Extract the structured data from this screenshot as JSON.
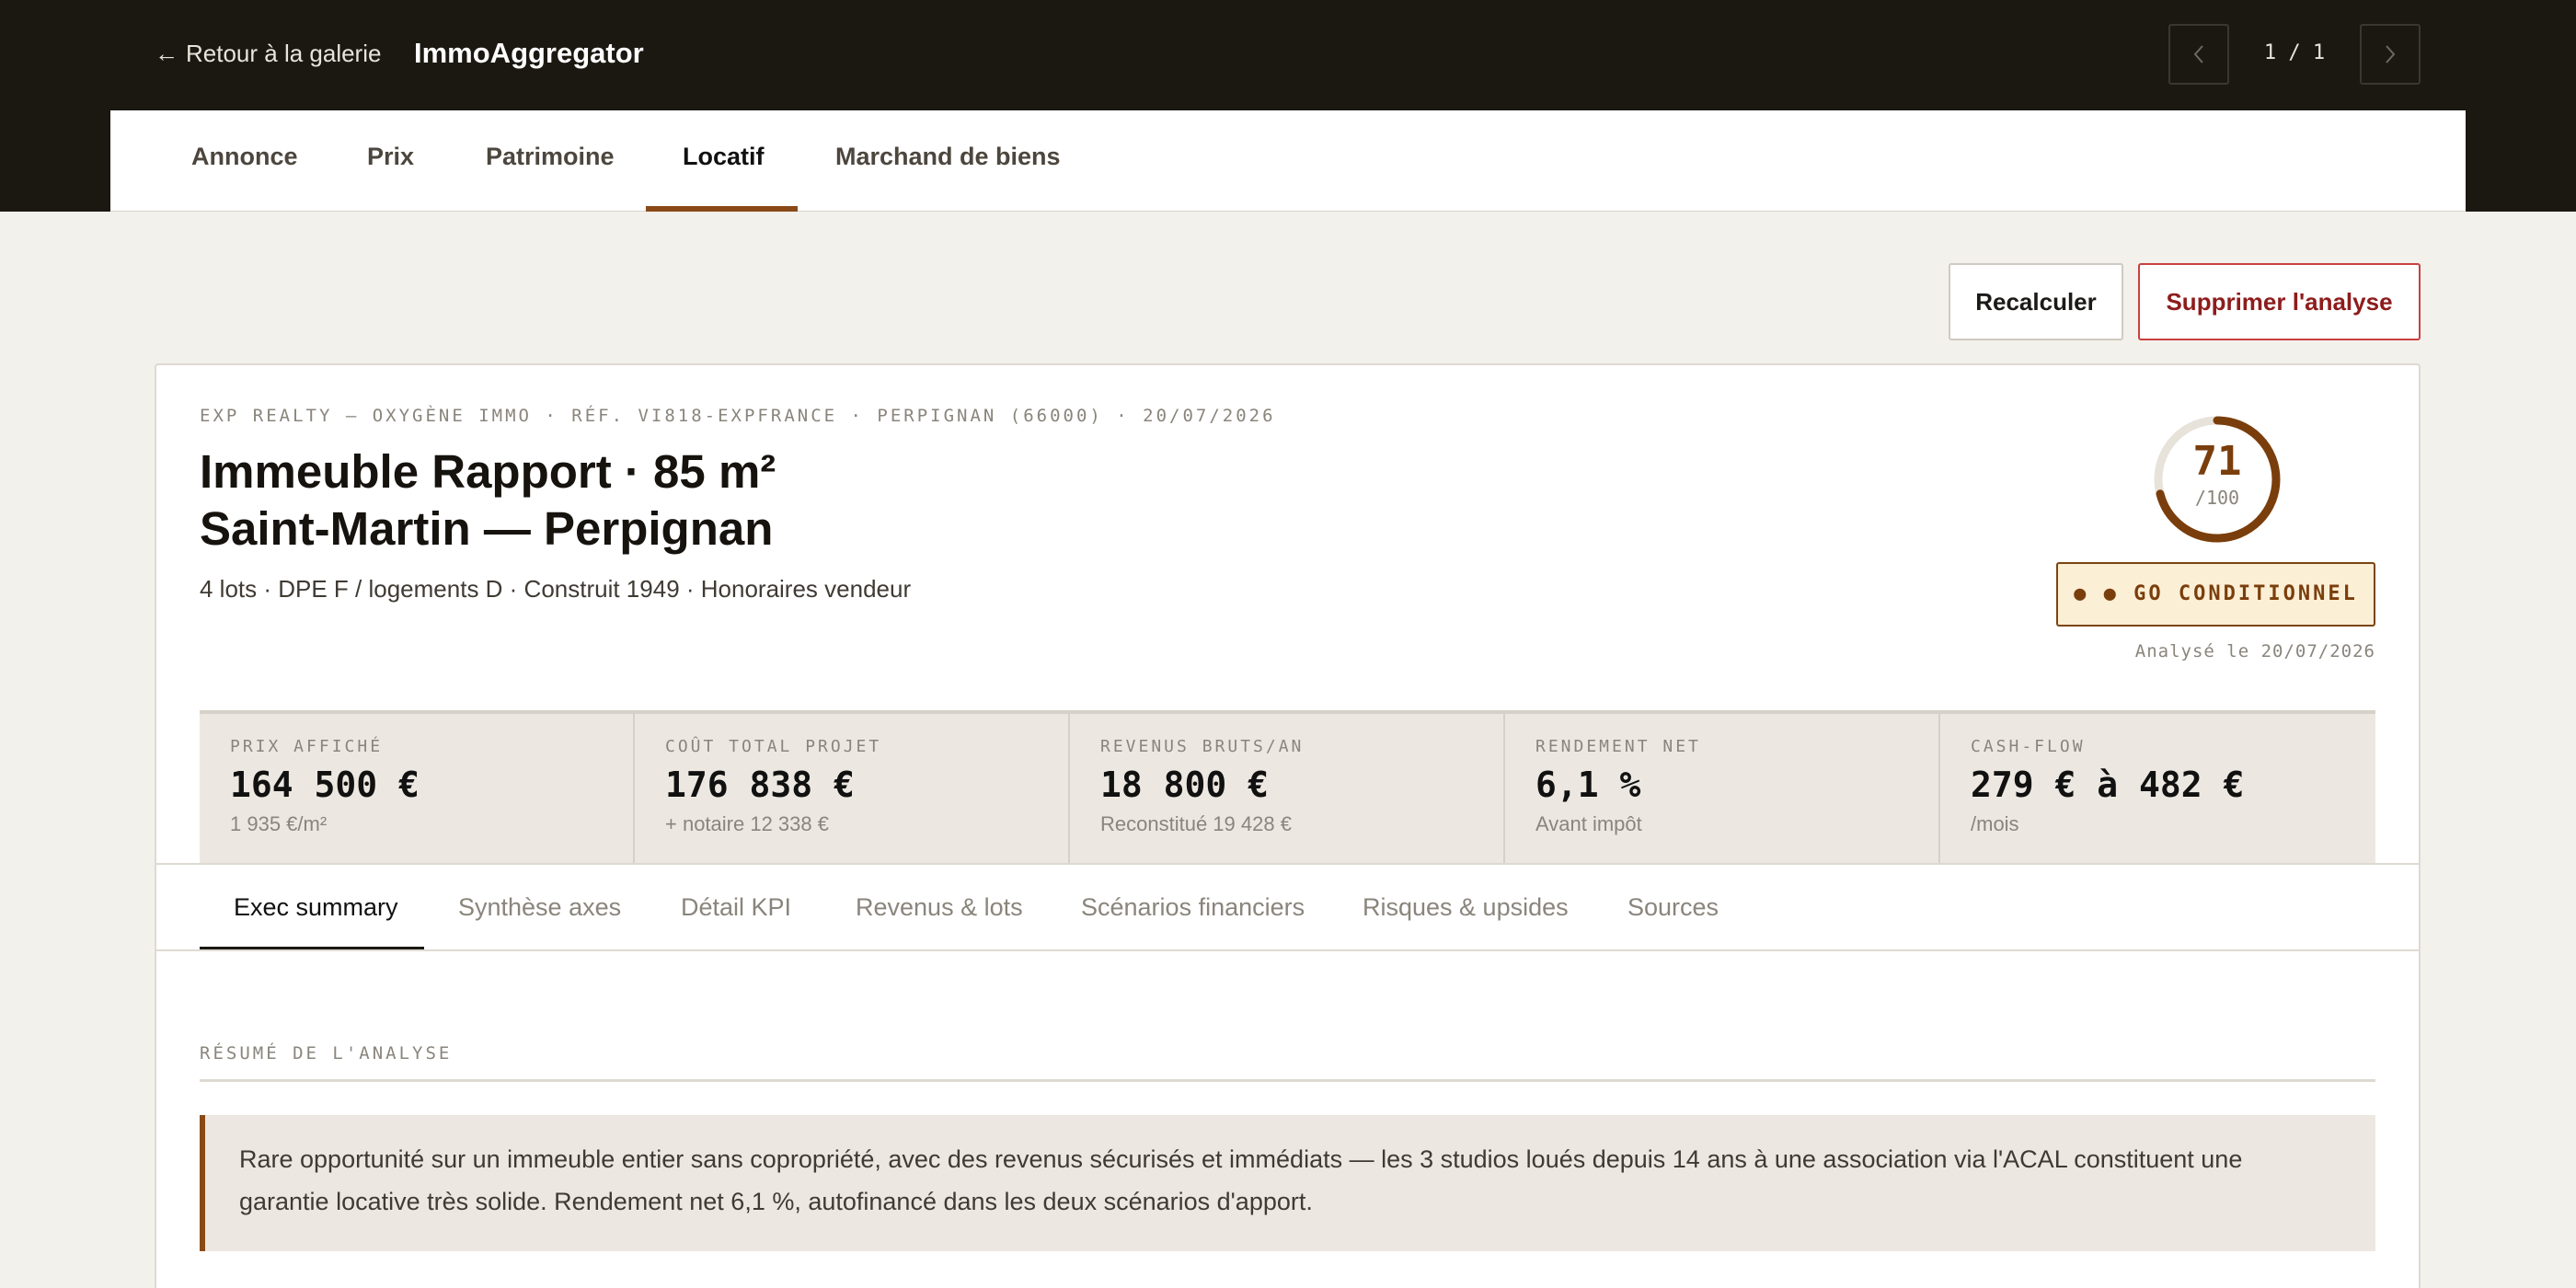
{
  "header": {
    "back_label": "Retour à la galerie",
    "back_arrow": "←",
    "app_title": "ImmoAggregator",
    "pager_text": "1 / 1",
    "prev_icon": "chevron-left-icon",
    "next_icon": "chevron-right-icon"
  },
  "main_tabs": {
    "items": [
      {
        "label": "Annonce"
      },
      {
        "label": "Prix"
      },
      {
        "label": "Patrimoine"
      },
      {
        "label": "Locatif"
      },
      {
        "label": "Marchand de biens"
      }
    ],
    "active": "Locatif"
  },
  "actions": {
    "recalc_label": "Recalculer",
    "delete_label": "Supprimer l'analyse"
  },
  "listing": {
    "meta": "EXP REALTY — OXYGÈNE IMMO · RÉF. VI818-EXPFRANCE · PERPIGNAN (66000) · 20/07/2026",
    "title_line1": "Immeuble Rapport · 85 m²",
    "title_line2": "Saint-Martin — Perpignan",
    "subtitle": "4 lots · DPE F / logements D · Construit 1949 · Honoraires vendeur"
  },
  "score": {
    "value": "71",
    "max": "/100",
    "fraction": 0.71,
    "verdict": "● ● GO CONDITIONNEL",
    "analysed": "Analysé le 20/07/2026"
  },
  "kpis": [
    {
      "label": "PRIX AFFICHÉ",
      "value": "164 500 €",
      "sub": "1 935 €/m²"
    },
    {
      "label": "COÛT TOTAL PROJET",
      "value": "176 838 €",
      "sub": "+ notaire 12 338 €"
    },
    {
      "label": "REVENUS BRUTS/AN",
      "value": "18 800 €",
      "sub": "Reconstitué 19 428 €"
    },
    {
      "label": "RENDEMENT NET",
      "value": "6,1 %",
      "sub": "Avant impôt"
    },
    {
      "label": "CASH-FLOW",
      "value": "279 € à 482 €",
      "sub": "/mois"
    }
  ],
  "sub_tabs": {
    "items": [
      {
        "label": "Exec summary"
      },
      {
        "label": "Synthèse axes"
      },
      {
        "label": "Détail KPI"
      },
      {
        "label": "Revenus & lots"
      },
      {
        "label": "Scénarios financiers"
      },
      {
        "label": "Risques & upsides"
      },
      {
        "label": "Sources"
      }
    ],
    "active": "Exec summary"
  },
  "summary": {
    "label": "RÉSUMÉ DE L'ANALYSE",
    "text": "Rare opportunité sur un immeuble entier sans copropriété, avec des revenus sécurisés et immédiats — les 3 studios loués depuis 14 ans à une association via l'ACAL constituent une garantie locative très solide. Rendement net 6,1 %, autofinancé dans les deux scénarios d'apport."
  },
  "colors": {
    "topbar": "#1b1812",
    "accent": "#8a4a17",
    "danger": "#c94040",
    "badge_bg": "#fbefd6"
  }
}
